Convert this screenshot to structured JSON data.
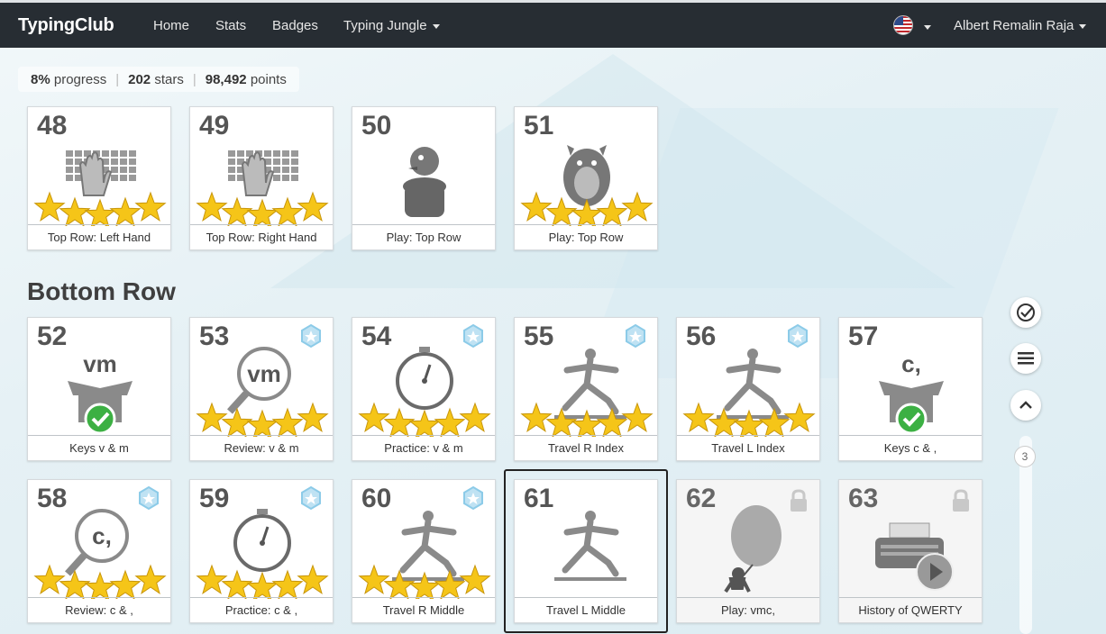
{
  "navbar": {
    "brand": "TypingClub",
    "items": [
      "Home",
      "Stats",
      "Badges",
      "Typing Jungle"
    ],
    "user": "Albert Remalin Raja",
    "language_icon": "us-flag-icon"
  },
  "progress": {
    "percent": "8%",
    "percent_label": "progress",
    "stars": "202",
    "stars_label": "stars",
    "points": "98,492",
    "points_label": "points"
  },
  "section": {
    "title": "Bottom Row"
  },
  "lessons": [
    {
      "num": "48",
      "label": "Top Row: Left Hand",
      "stars": 5,
      "icon": "keyboard-left-hand-icon",
      "badge": false,
      "locked": false
    },
    {
      "num": "49",
      "label": "Top Row: Right Hand",
      "stars": 5,
      "icon": "keyboard-right-hand-icon",
      "badge": false,
      "locked": false
    },
    {
      "num": "50",
      "label": "Play: Top Row",
      "stars": 0,
      "icon": "bird-in-pot-icon",
      "badge": false,
      "locked": false
    },
    {
      "num": "51",
      "label": "Play: Top Row",
      "stars": 5,
      "icon": "monster-icon",
      "badge": false,
      "locked": false
    },
    {
      "num": "52",
      "label": "Keys v & m",
      "stars": 0,
      "icon": "box-check-icon",
      "keys": "vm",
      "badge": false,
      "locked": false
    },
    {
      "num": "53",
      "label": "Review: v & m",
      "stars": 5,
      "icon": "magnifier-icon",
      "keys": "vm",
      "badge": true,
      "locked": false
    },
    {
      "num": "54",
      "label": "Practice: v & m",
      "stars": 5,
      "icon": "stopwatch-icon",
      "badge": true,
      "locked": false
    },
    {
      "num": "55",
      "label": "Travel R Index",
      "stars": 5,
      "icon": "yoga-pose-icon",
      "badge": true,
      "locked": false
    },
    {
      "num": "56",
      "label": "Travel L Index",
      "stars": 5,
      "icon": "yoga-pose-icon",
      "badge": true,
      "locked": false
    },
    {
      "num": "57",
      "label": "Keys c & ,",
      "stars": 0,
      "icon": "box-check-icon",
      "keys": "c,",
      "badge": false,
      "locked": false
    },
    {
      "num": "58",
      "label": "Review: c & ,",
      "stars": 5,
      "icon": "magnifier-icon",
      "keys": "c,",
      "badge": true,
      "locked": false
    },
    {
      "num": "59",
      "label": "Practice: c & ,",
      "stars": 5,
      "icon": "stopwatch-icon",
      "badge": true,
      "locked": false
    },
    {
      "num": "60",
      "label": "Travel R Middle",
      "stars": 5,
      "icon": "yoga-pose-icon",
      "badge": true,
      "locked": false
    },
    {
      "num": "61",
      "label": "Travel L Middle",
      "stars": 0,
      "icon": "yoga-pose-icon",
      "badge": false,
      "locked": false,
      "selected": true
    },
    {
      "num": "62",
      "label": "Play: vmc,",
      "stars": 0,
      "icon": "balloon-ninja-icon",
      "badge": false,
      "locked": true
    },
    {
      "num": "63",
      "label": "History of QWERTY",
      "stars": 0,
      "icon": "typewriter-video-icon",
      "badge": false,
      "locked": true
    }
  ],
  "sidebar": {
    "page": "3"
  },
  "colors": {
    "navbar": "#272d33",
    "star": "#f5c518",
    "check": "#3cb043",
    "badge": "#8ccbe8"
  }
}
